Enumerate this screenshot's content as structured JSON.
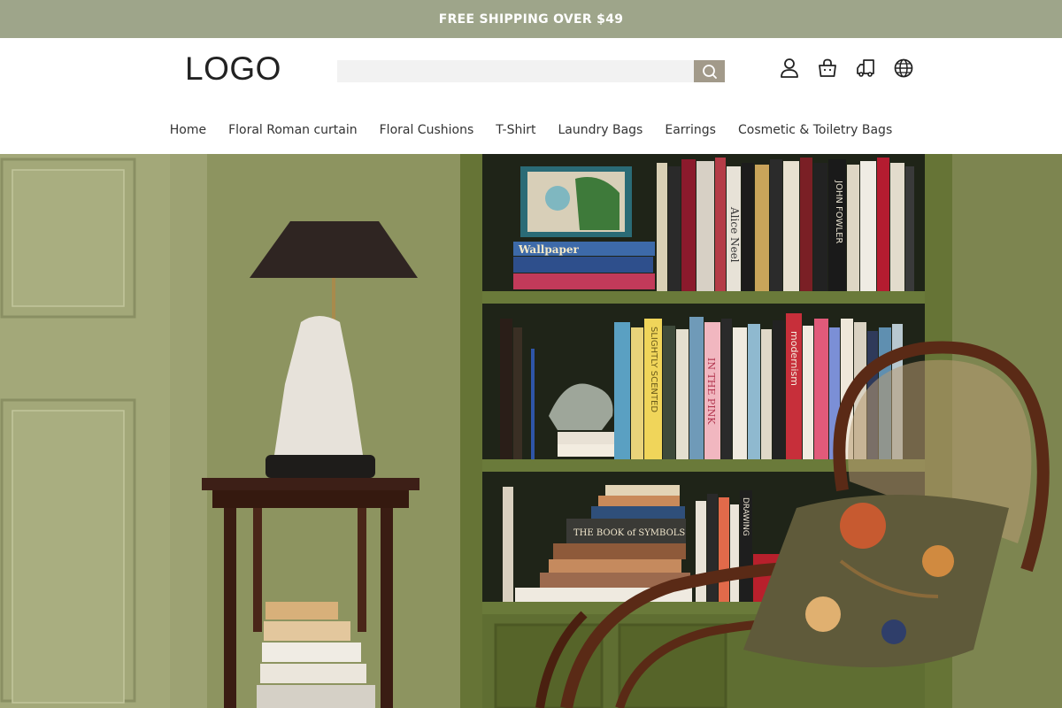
{
  "announcement": {
    "text": "FREE SHIPPING OVER $49"
  },
  "header": {
    "logo": "LOGO",
    "search": {
      "placeholder": "",
      "value": ""
    },
    "icons": [
      "user-icon",
      "cart-icon",
      "shipping-truck-icon",
      "globe-icon"
    ]
  },
  "nav": {
    "items": [
      {
        "label": "Home"
      },
      {
        "label": "Floral Roman curtain"
      },
      {
        "label": "Floral Cushions"
      },
      {
        "label": "T-Shirt"
      },
      {
        "label": "Laundry Bags"
      },
      {
        "label": "Earrings"
      },
      {
        "label": "Cosmetic & Toiletry Bags"
      }
    ]
  },
  "hero": {
    "book_texts": [
      "Wallpaper",
      "THE BOOK of SYMBOLS",
      "Alice Neel",
      "JOHN FOWLER",
      "IN THE PINK",
      "SLIGHTLY SCENTED",
      "modernism",
      "DRAWING"
    ]
  },
  "colors": {
    "announcement_bg": "#9ea58a",
    "search_button_bg": "#a29a8a",
    "wall": "#8f9665",
    "shelf": "#6a7a3a",
    "door_panel": "#a3a879"
  }
}
